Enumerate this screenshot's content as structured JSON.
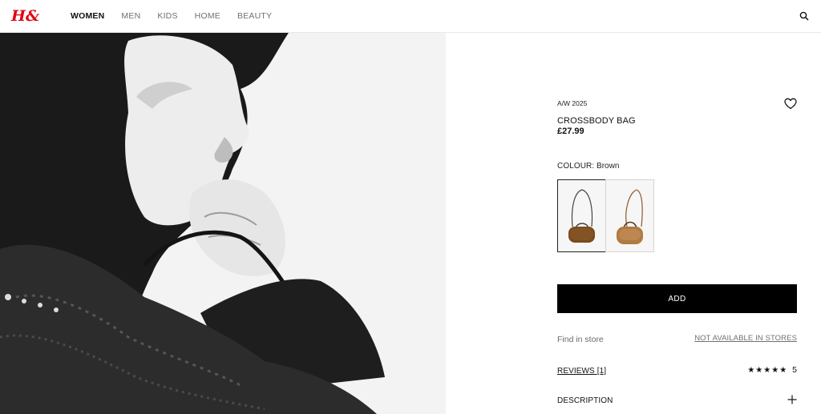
{
  "header": {
    "logo": "H&M",
    "nav": [
      {
        "label": "WOMEN",
        "active": true
      },
      {
        "label": "MEN",
        "active": false
      },
      {
        "label": "KIDS",
        "active": false
      },
      {
        "label": "HOME",
        "active": false
      },
      {
        "label": "BEAUTY",
        "active": false
      }
    ],
    "search_icon": "search-icon"
  },
  "product": {
    "season": "A/W 2025",
    "name": "CROSSBODY BAG",
    "price": "£27.99",
    "colour_label": "COLOUR:",
    "colour_value": "Brown",
    "swatches": [
      {
        "name": "dark brown",
        "selected": true,
        "fur": "#7a4a1e"
      },
      {
        "name": "light brown",
        "selected": false,
        "fur": "#b07a43"
      }
    ],
    "add_label": "ADD",
    "find_in_store": "Find in store",
    "availability": "NOT AVAILABLE IN STORES",
    "reviews_label": "REVIEWS [1]",
    "stars": "★★★★★",
    "rating": "5",
    "description_label": "DESCRIPTION"
  },
  "colors": {
    "brand_red": "#e50010",
    "button_bg": "#000000"
  }
}
